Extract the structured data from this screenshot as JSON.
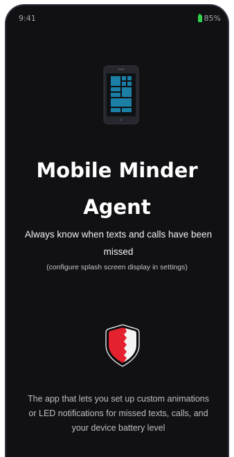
{
  "status_bar": {
    "time": "9:41",
    "battery_level": "85%",
    "battery_color": "#2fd14a"
  },
  "splash": {
    "app_icon": "phone-tiles-icon",
    "title": "Mobile Minder Agent",
    "tagline": "Always know when texts and calls have been missed",
    "config_hint": "(configure splash screen display in settings)",
    "brand_icon": "shield-icon",
    "description": "The app that lets you set up custom animations or LED notifications for missed texts, calls, and your device battery level"
  },
  "colors": {
    "background": "#111114",
    "tile_blue": "#1b7fa6",
    "shield_red": "#e4222f"
  }
}
